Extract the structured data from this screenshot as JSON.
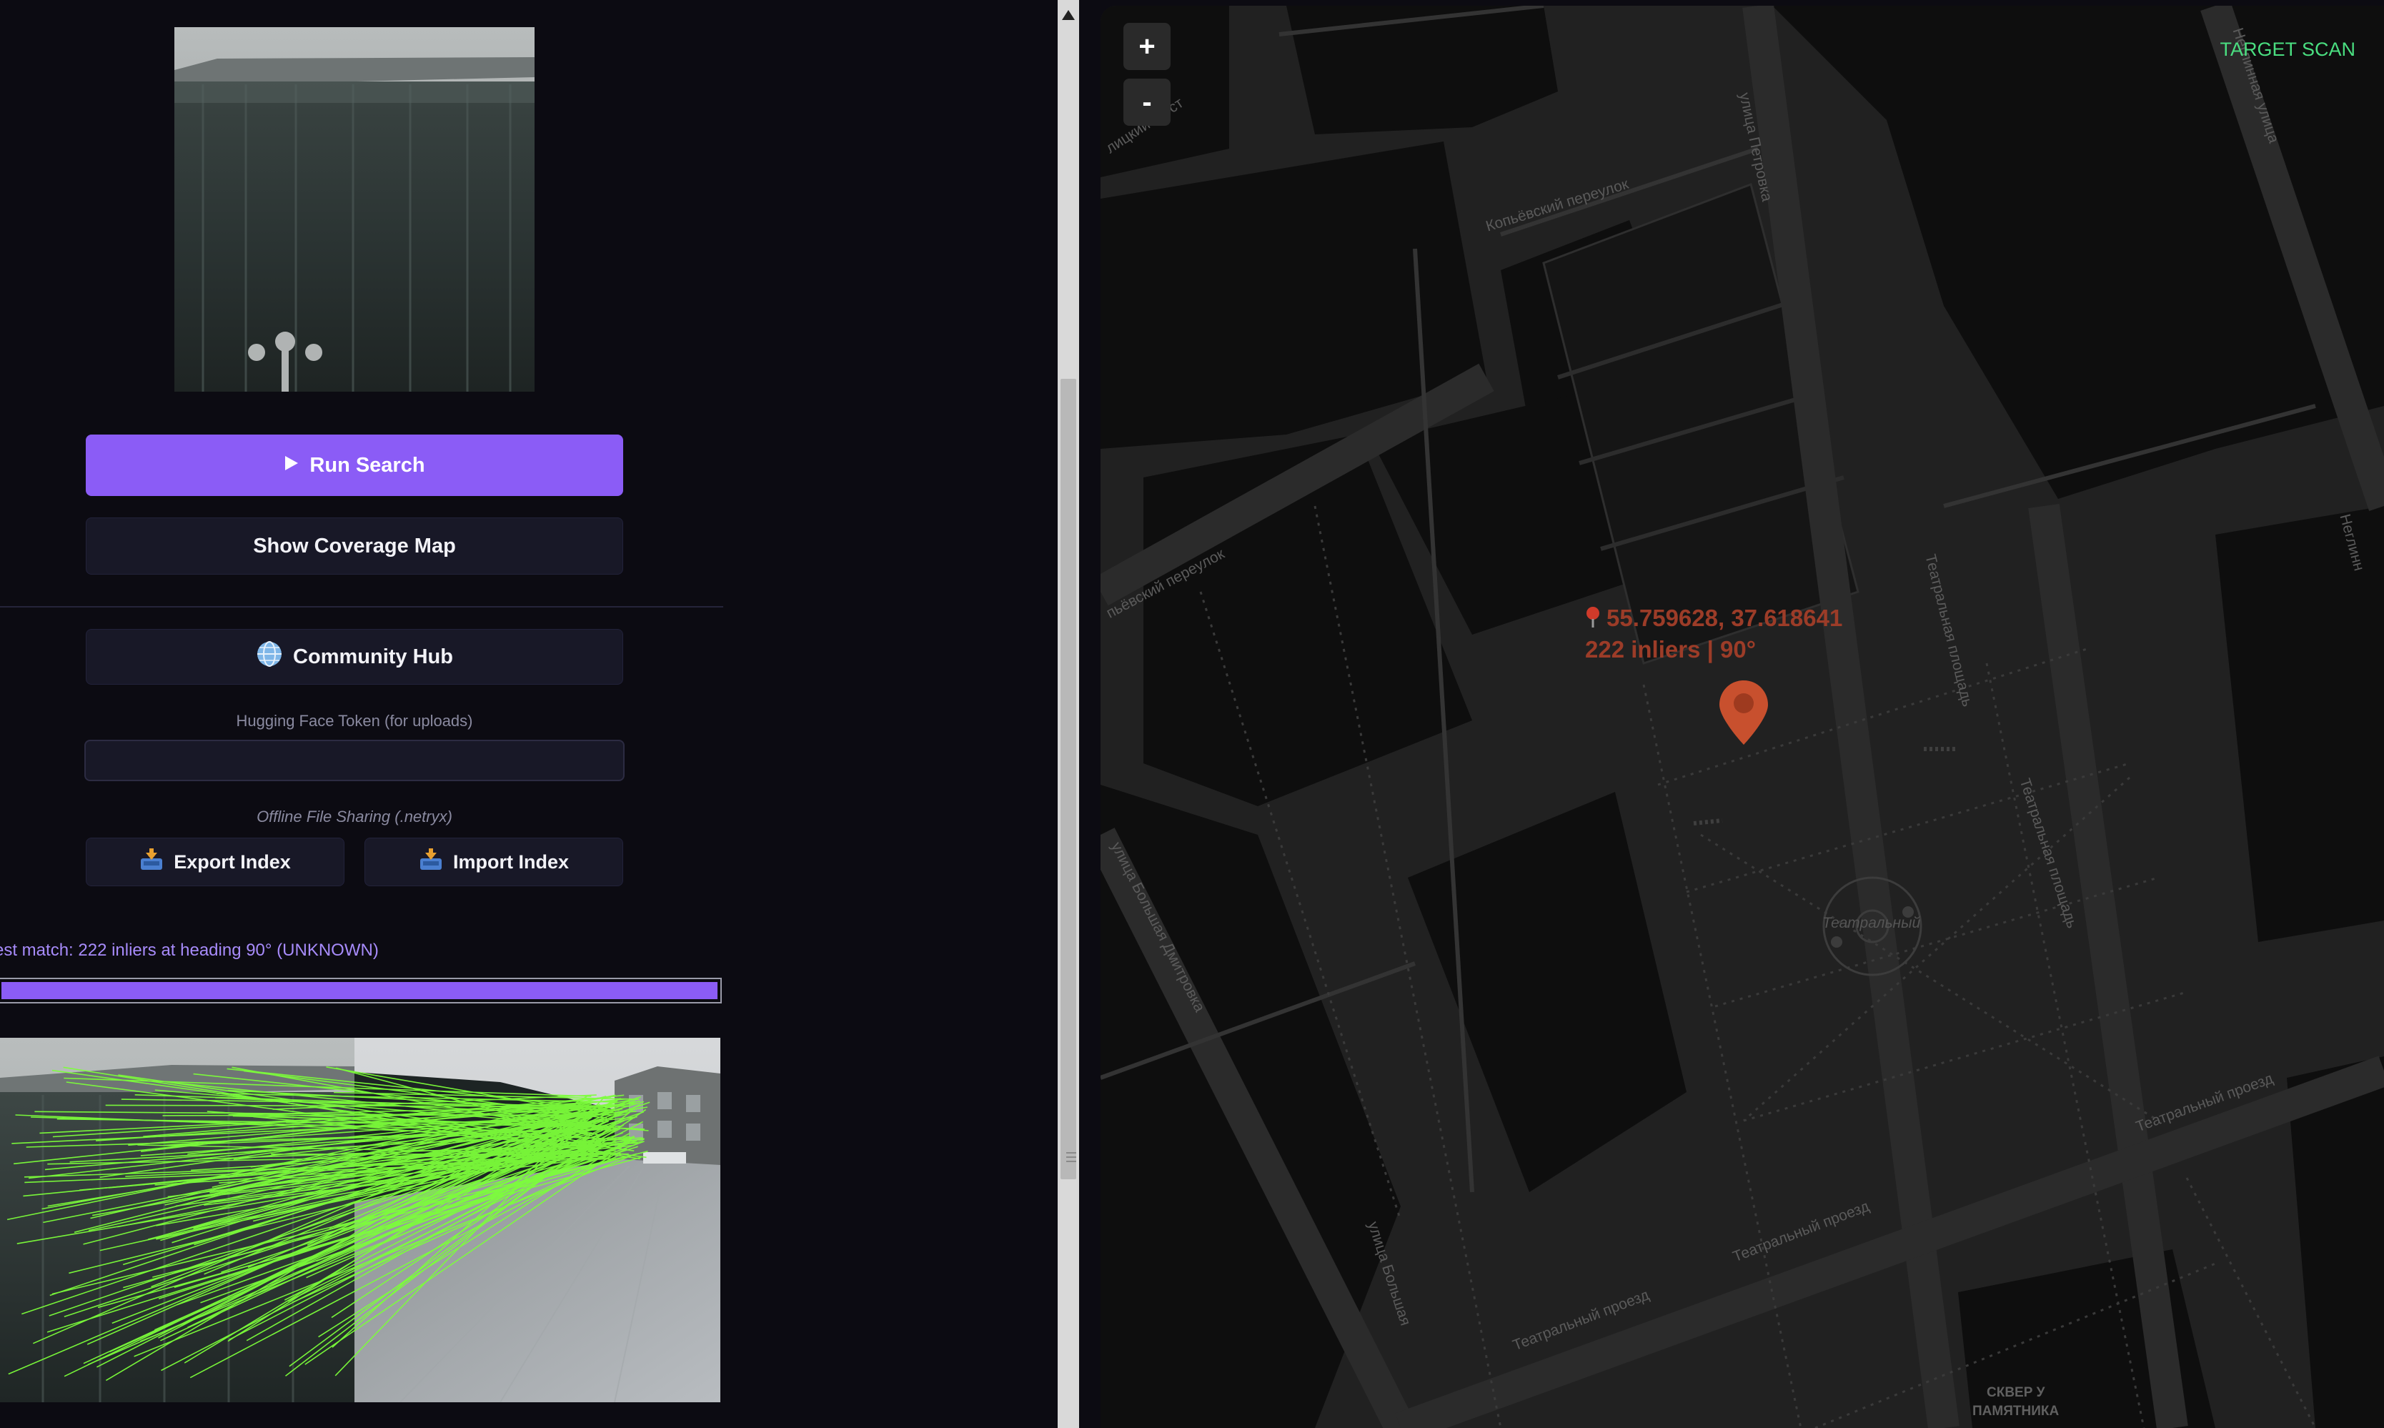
{
  "sidebar": {
    "run_search_label": "Run Search",
    "show_coverage_label": "Show Coverage Map",
    "community_hub_label": "Community Hub",
    "token_label": "Hugging Face Token (for uploads)",
    "token_value": "",
    "offline_label": "Offline File Sharing (.netryx)",
    "export_label": "Export Index",
    "import_label": "Import Index",
    "status_text": "est match: 222 inliers at heading 90° (UNKNOWN)",
    "progress_fraction": 1.0
  },
  "map": {
    "zoom_in_label": "+",
    "zoom_out_label": "-",
    "target_scan_label": "TARGET SCAN",
    "marker": {
      "coordinates": "55.759628, 37.618641",
      "stats": "222 inliers | 90°",
      "color": "#c8502e"
    },
    "streets": {
      "petrovka": "улица Петровка",
      "kopyovsky": "Копьёвский переулок",
      "kopyovsky_w": "пьёвский переулок",
      "kuznetsky": "лицкий Мост",
      "neglinnaya": "Неглинная улица",
      "teatralnaya_1": "Театральная площадь",
      "teatralnaya_2": "Театральная площадь",
      "teatralny_square": "Театральный",
      "bolshaya_dmitrovka": "улица Большая Дмитровка",
      "bolshaya_dmitrovka_2": "улица Большая",
      "teatralny_proezd_1": "Театральный проезд",
      "teatralny_proezd_2": "Театральный проезд",
      "teatralny_proezd_3": "Театральный проезд",
      "skver": "СКВЕР У",
      "pamyatnika": "ПАМЯТНИКА",
      "neglinnaya_e": "Неглинн"
    }
  },
  "icons": {
    "run": "play-icon",
    "hub": "globe-icon",
    "export": "inbox-tray-icon",
    "import": "inbox-tray-icon",
    "marker": "map-pin-icon"
  },
  "colors": {
    "accent": "#8b5cf6",
    "match_lines": "#7cff3a",
    "target_scan": "#4ade80",
    "status_text": "#a78bfa"
  }
}
